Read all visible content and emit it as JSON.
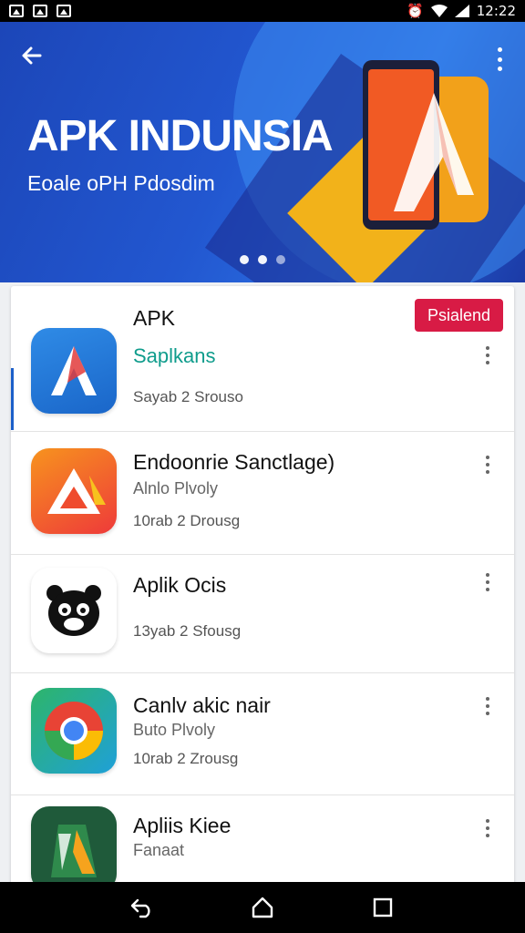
{
  "status_bar": {
    "time": "12:22",
    "left_icons": [
      "image-icon",
      "image-icon",
      "image-icon"
    ],
    "right_icons": [
      "alarm-icon",
      "wifi-icon",
      "signal-icon"
    ]
  },
  "hero": {
    "title": "APK INDUNSIA",
    "subtitle": "Eoale oPH Pdosdim",
    "back_icon": "back-arrow-icon",
    "menu_icon": "more-vert-icon",
    "page_indicator": {
      "total": 3,
      "active": 0
    }
  },
  "list": {
    "items": [
      {
        "title": "APK",
        "subtitle": "Saplkans",
        "meta": "Sayab 2 Srouso",
        "badge": "Psialend",
        "icon": "apk-a-logo-icon"
      },
      {
        "title": "Endoonrie Sanctlage)",
        "subtitle": "Alnlo Plvoly",
        "meta": "10rab 2 Drousg",
        "badge": "",
        "icon": "triangle-a-logo-icon"
      },
      {
        "title": "Aplik Ocis",
        "subtitle": "",
        "meta": "13yab 2 Sfousg",
        "badge": "",
        "icon": "bear-face-icon"
      },
      {
        "title": "Canlv akic nair",
        "subtitle": "Buto Plvoly",
        "meta": "10rab 2 Zrousg",
        "badge": "",
        "icon": "chrome-logo-icon"
      },
      {
        "title": "Apliis Kiee",
        "subtitle": "Fanaat",
        "meta": "",
        "badge": "",
        "icon": "green-a-logo-icon"
      }
    ]
  },
  "nav_bar": {
    "back": "nav-back-icon",
    "home": "nav-home-icon",
    "recents": "nav-recents-icon"
  },
  "colors": {
    "hero_blue": "#2257d0",
    "accent_orange": "#f2b21a",
    "badge_red": "#d81b45",
    "teal_text": "#0f9c8c"
  }
}
